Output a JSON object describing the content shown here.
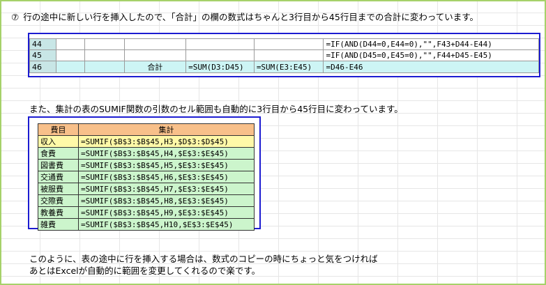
{
  "intro": {
    "number": "⑦",
    "text": "行の途中に新しい行を挿入したので、「合計」の欄の数式はちゃんと3行目から45行目までの合計に変わっています。"
  },
  "sheet_top": {
    "rows": [
      {
        "row": "44",
        "c2": "",
        "c3": "",
        "c4": "",
        "c5": "",
        "c6": "",
        "formula": "=IF(AND(D44=0,E44=0),\"\",F43+D44-E44)"
      },
      {
        "row": "45",
        "c2": "",
        "c3": "",
        "c4": "",
        "c5": "",
        "c6": "",
        "formula": "=IF(AND(D45=0,E45=0),\"\",F44+D45-E45)"
      },
      {
        "row": "46",
        "c2": "",
        "c3": "",
        "c4": "合計",
        "c5": "=SUM(D3:D45)",
        "c6": "=SUM(E3:E45)",
        "formula": "=D46-E46"
      }
    ]
  },
  "middle_note": "また、集計の表のSUMIF関数の引数のセル範囲も自動的に3行目から45行目に変わっています。",
  "summary": {
    "headers": [
      "費目",
      "集計"
    ],
    "rows": [
      {
        "cat": "収入",
        "formula": "=SUMIF($B$3:$B$45,H3,$D$3:$D$45)"
      },
      {
        "cat": "食費",
        "formula": "=SUMIF($B$3:$B$45,H4,$E$3:$E$45)"
      },
      {
        "cat": "図書費",
        "formula": "=SUMIF($B$3:$B$45,H5,$E$3:$E$45)"
      },
      {
        "cat": "交通費",
        "formula": "=SUMIF($B$3:$B$45,H6,$E$3:$E$45)"
      },
      {
        "cat": "被服費",
        "formula": "=SUMIF($B$3:$B$45,H7,$E$3:$E$45)"
      },
      {
        "cat": "交際費",
        "formula": "=SUMIF($B$3:$B$45,H8,$E$3:$E$45)"
      },
      {
        "cat": "教養費",
        "formula": "=SUMIF($B$3:$B$45,H9,$E$3:$E$45)"
      },
      {
        "cat": "雑費",
        "formula": "=SUMIF($B$3:$B$45,H10,$E$3:$E$45)"
      }
    ]
  },
  "closing": {
    "line1": "このように、表の途中に行を挿入する場合は、数式のコピーの時にちょっと気をつければ",
    "line2": "あとはExcelが自動的に範囲を変更してくれるので楽です。"
  },
  "colors": {
    "frame": "#a6d16a",
    "border_blue": "#1c1cd1",
    "highlight_row": "#cdf5f5",
    "header_orange": "#f8c08a",
    "first_row_yellow": "#fff9a8",
    "data_green": "#ccf5cc"
  }
}
